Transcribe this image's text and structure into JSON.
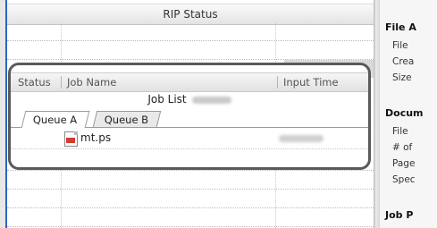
{
  "rip_status": {
    "header": "RIP Status"
  },
  "job_list": {
    "columns": [
      "Status",
      "Job Name",
      "Input Time"
    ],
    "title": "Job List",
    "tabs": [
      "Queue A",
      "Queue B"
    ],
    "active_tab": "Queue A",
    "rows": [
      {
        "name": "mt.ps",
        "icon": "pdf-file-icon"
      }
    ]
  },
  "properties": {
    "sections": [
      {
        "heading": "File A",
        "items": [
          "File",
          "Crea",
          "Size"
        ]
      },
      {
        "heading": "Docum",
        "items": [
          "File",
          "# of",
          "Page",
          "Spec"
        ]
      },
      {
        "heading": "Job P",
        "items": []
      }
    ]
  },
  "colors": {
    "accent_blue": "#2a66c8",
    "zoom_border": "#5a5a5a"
  }
}
